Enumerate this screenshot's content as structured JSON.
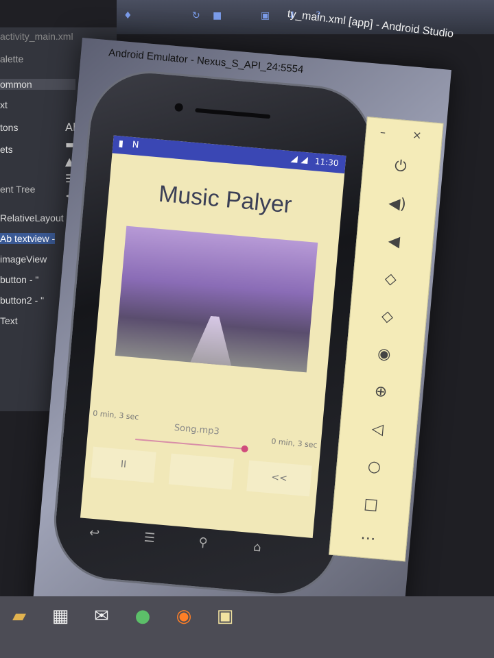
{
  "android_studio": {
    "window_title": "ty_main.xml [app] - Android Studio",
    "file_tab": "activity_main.xml",
    "left_panel": {
      "palette_label": "alette",
      "items": [
        "ommon",
        "xt",
        "tons",
        "ets"
      ],
      "component_tree_label": "ent Tree",
      "tree": [
        "RelativeLayout",
        "Ab textview -",
        "imageView",
        "button - \"",
        "button2 - \"",
        "Text"
      ]
    }
  },
  "emulator": {
    "window_title": "Android Emulator - Nexus_S_API_24:5554",
    "statusbar": {
      "time": "11:30"
    },
    "app": {
      "title": "Music Palyer",
      "song_name": "Song.mp3",
      "time_left": "0 min, 3 sec",
      "time_right": "0 min, 3 sec",
      "pause_label": "II",
      "rewind_label": "<<",
      "seek_fraction": 1.0
    },
    "side_controls": [
      "power-icon",
      "volume-up-icon",
      "volume-down-icon",
      "rotate-left-icon",
      "rotate-right-icon",
      "camera-icon",
      "zoom-icon",
      "back-icon",
      "home-icon",
      "overview-icon",
      "more-icon"
    ],
    "window_controls": {
      "minimize": "–",
      "close": "×"
    }
  },
  "colors": {
    "statusbar": "#3a47b4",
    "screen_bg": "#f1e8b8",
    "seek": "#d04c7c"
  }
}
